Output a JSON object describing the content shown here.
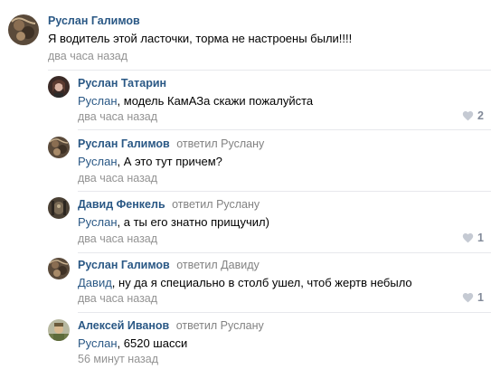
{
  "comments": [
    {
      "author": "Руслан Галимов",
      "reply_prefix": "",
      "reply_target": "",
      "mention": "",
      "text": "Я водитель этой ласточки, торма не настроены были!!!!",
      "time": "два часа назад",
      "likes": "",
      "avatar_icon": "user-avatar-icon"
    },
    {
      "author": "Руслан Татарин",
      "reply_prefix": "",
      "reply_target": "",
      "mention": "Руслан",
      "text": ", модель КамАЗа скажи пожалуйста",
      "time": "два часа назад",
      "likes": "2",
      "avatar_icon": "user-avatar-icon"
    },
    {
      "author": "Руслан Галимов",
      "reply_prefix": "ответил",
      "reply_target": "Руслану",
      "mention": "Руслан",
      "text": ", А это тут причем?",
      "time": "два часа назад",
      "likes": "",
      "avatar_icon": "user-avatar-icon"
    },
    {
      "author": "Давид Фенкель",
      "reply_prefix": "ответил",
      "reply_target": "Руслану",
      "mention": "Руслан",
      "text": ", а ты его знатно прищучил)",
      "time": "два часа назад",
      "likes": "1",
      "avatar_icon": "user-avatar-icon"
    },
    {
      "author": "Руслан Галимов",
      "reply_prefix": "ответил",
      "reply_target": "Давиду",
      "mention": "Давид",
      "text": ", ну да я специально в столб ушел, чтоб жертв небыло",
      "time": "два часа назад",
      "likes": "1",
      "avatar_icon": "user-avatar-icon"
    },
    {
      "author": "Алексей Иванов",
      "reply_prefix": "ответил",
      "reply_target": "Руслану",
      "mention": "Руслан",
      "text": ", 6520 шасси",
      "time": "56 минут назад",
      "likes": "",
      "avatar_icon": "user-avatar-icon"
    }
  ],
  "colors": {
    "link": "#2a5885",
    "meta": "#939393",
    "like": "#828a99",
    "divider": "#e7e8ec"
  },
  "icons": {
    "like": "heart-icon"
  }
}
